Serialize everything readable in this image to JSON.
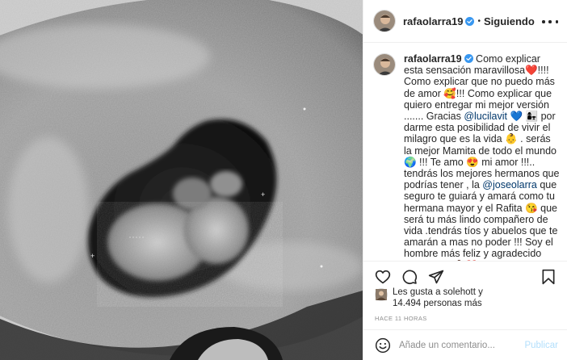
{
  "post": {
    "image": {
      "alt": "ultrasound scan",
      "icon": "ultrasound-image"
    },
    "header": {
      "username": "rafaolarra19",
      "verified_icon": "verified-badge-icon",
      "separator": "•",
      "follow_status": "Siguiendo",
      "more_icon": "more-options-icon"
    },
    "caption": {
      "username": "rafaolarra19",
      "part1": " Como explicar esta sensación maravillosa",
      "emoji1": "❤️",
      "part2": "!!!! Como explicar que no puedo más de amor ",
      "emoji2": "🥰",
      "part3": "!!! Como explicar que quiero entregar mi mejor versión ....... Gracias ",
      "mention1": "@lucilavit",
      "emoji3": " 💙 👩‍👧 ",
      "part4": "por darme esta posibilidad de vivir el milagro que es la vida ",
      "emoji4": "👶",
      "part5": " . serás la mejor Mamita de todo el mundo ",
      "emoji5": "🌍",
      "part6": " !!! Te amo ",
      "emoji6": "😍",
      "part7": " mi amor !!!.. tendrás los mejores hermanos que podrías tener , la ",
      "mention2": "@joseolarra",
      "part8": " que seguro te guiará y amará como tu hermana mayor y el Rafita ",
      "emoji7": "😘",
      "part9": " que será tu más lindo compañero de vida .tendrás tíos y abuelos que te amarán a mas no poder !!! Soy el hombre más feliz y agradecido que existe ",
      "emoji8": "👶❤️"
    },
    "actions": {
      "like_icon": "heart-icon",
      "comment_icon": "comment-icon",
      "share_icon": "share-icon",
      "save_icon": "bookmark-icon"
    },
    "likes": {
      "prefix": "Les gusta a ",
      "user": "solehott",
      "middle": " y ",
      "count": "14.494",
      "suffix": " personas más"
    },
    "timestamp": "HACE 11 HORAS",
    "add_comment": {
      "emoji_icon": "emoji-smiley-icon",
      "placeholder": "Añade un comentario...",
      "publish_label": "Publicar"
    },
    "colors": {
      "text": "#262626",
      "muted": "#8e8e8e",
      "mention": "#00376b",
      "verified": "#3897f0",
      "publish_disabled": "#b2dffc",
      "divider": "#efefef"
    }
  }
}
